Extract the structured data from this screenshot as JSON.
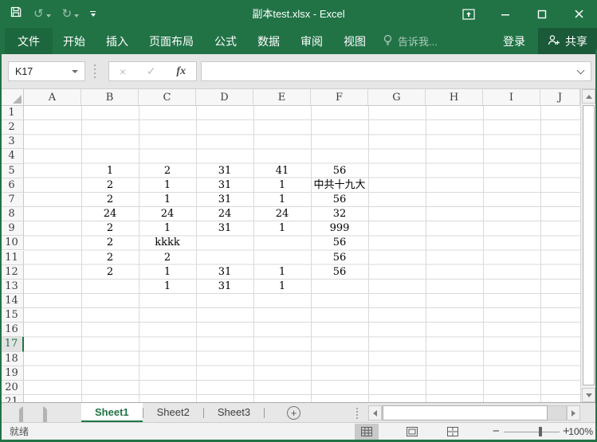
{
  "window": {
    "title": "副本test.xlsx - Excel",
    "theme_green": "#217346",
    "share_green": "#1a5a38"
  },
  "icons": {
    "undo": "↺",
    "redo": "↻",
    "cancel": "×",
    "enter": "✓",
    "insert_function": "fx",
    "new_sheet": "+",
    "zoom_out": "−",
    "zoom_in": "+"
  },
  "ribbon": {
    "file_tab": "文件",
    "tabs": [
      "开始",
      "插入",
      "页面布局",
      "公式",
      "数据",
      "审阅",
      "视图"
    ],
    "tell_me": "告诉我...",
    "sign_in": "登录",
    "share_label": "共享"
  },
  "formula_bar": {
    "name_box": "K17",
    "formula_value": ""
  },
  "grid": {
    "columns": [
      "A",
      "B",
      "C",
      "D",
      "E",
      "F",
      "G",
      "H",
      "I",
      "J"
    ],
    "row_count": 21,
    "active_cell": "K17",
    "active_row": 17,
    "cells": [
      {
        "r": 5,
        "c": "B",
        "v": "1"
      },
      {
        "r": 5,
        "c": "C",
        "v": "2"
      },
      {
        "r": 5,
        "c": "D",
        "v": "31"
      },
      {
        "r": 5,
        "c": "E",
        "v": "41"
      },
      {
        "r": 5,
        "c": "F",
        "v": "56"
      },
      {
        "r": 6,
        "c": "B",
        "v": "2"
      },
      {
        "r": 6,
        "c": "C",
        "v": "1"
      },
      {
        "r": 6,
        "c": "D",
        "v": "31"
      },
      {
        "r": 6,
        "c": "E",
        "v": "1"
      },
      {
        "r": 6,
        "c": "F",
        "v": "中共十九大"
      },
      {
        "r": 7,
        "c": "B",
        "v": "2"
      },
      {
        "r": 7,
        "c": "C",
        "v": "1"
      },
      {
        "r": 7,
        "c": "D",
        "v": "31"
      },
      {
        "r": 7,
        "c": "E",
        "v": "1"
      },
      {
        "r": 7,
        "c": "F",
        "v": "56"
      },
      {
        "r": 8,
        "c": "B",
        "v": "24"
      },
      {
        "r": 8,
        "c": "C",
        "v": "24"
      },
      {
        "r": 8,
        "c": "D",
        "v": "24"
      },
      {
        "r": 8,
        "c": "E",
        "v": "24"
      },
      {
        "r": 8,
        "c": "F",
        "v": "32"
      },
      {
        "r": 9,
        "c": "B",
        "v": "2"
      },
      {
        "r": 9,
        "c": "C",
        "v": "1"
      },
      {
        "r": 9,
        "c": "D",
        "v": "31"
      },
      {
        "r": 9,
        "c": "E",
        "v": "1"
      },
      {
        "r": 9,
        "c": "F",
        "v": "999"
      },
      {
        "r": 10,
        "c": "B",
        "v": "2"
      },
      {
        "r": 10,
        "c": "C",
        "v": "kkkk"
      },
      {
        "r": 10,
        "c": "F",
        "v": "56"
      },
      {
        "r": 11,
        "c": "B",
        "v": "2"
      },
      {
        "r": 11,
        "c": "C",
        "v": "2"
      },
      {
        "r": 11,
        "c": "F",
        "v": "56"
      },
      {
        "r": 12,
        "c": "B",
        "v": "2"
      },
      {
        "r": 12,
        "c": "C",
        "v": "1"
      },
      {
        "r": 12,
        "c": "D",
        "v": "31"
      },
      {
        "r": 12,
        "c": "E",
        "v": "1"
      },
      {
        "r": 12,
        "c": "F",
        "v": "56"
      },
      {
        "r": 13,
        "c": "C",
        "v": "1"
      },
      {
        "r": 13,
        "c": "D",
        "v": "31"
      },
      {
        "r": 13,
        "c": "E",
        "v": "1"
      }
    ]
  },
  "sheet_tabs": {
    "tabs": [
      {
        "label": "Sheet1",
        "active": true
      },
      {
        "label": "Sheet2",
        "active": false
      },
      {
        "label": "Sheet3",
        "active": false
      }
    ]
  },
  "status_bar": {
    "mode": "就绪",
    "zoom_level": "100%"
  }
}
